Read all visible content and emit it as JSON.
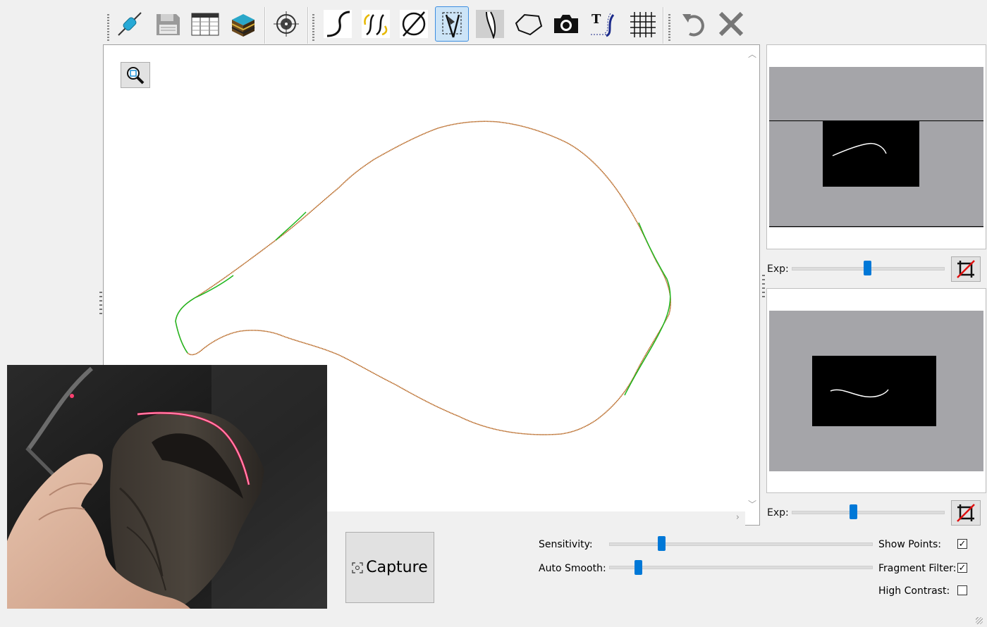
{
  "toolbar": {
    "buttons": [
      {
        "name": "connect-icon"
      },
      {
        "name": "save-icon"
      },
      {
        "name": "table-icon"
      },
      {
        "name": "layers-icon"
      },
      {
        "name": "target-icon"
      },
      {
        "name": "curve-icon"
      },
      {
        "name": "swap-curves-icon"
      },
      {
        "name": "diameter-icon"
      },
      {
        "name": "select-fragment-icon",
        "active": true
      },
      {
        "name": "profile-icon"
      },
      {
        "name": "polygon-icon"
      },
      {
        "name": "camera-icon"
      },
      {
        "name": "text-curve-icon"
      },
      {
        "name": "grid-icon"
      },
      {
        "name": "undo-icon"
      },
      {
        "name": "close-icon"
      }
    ]
  },
  "canvas": {
    "zoom_icon": "zoom-fit-icon",
    "curve_colors": {
      "main": "#b15a10",
      "highlight": "#1fb81f"
    }
  },
  "preview_top": {
    "exp_label": "Exp:",
    "exp_value": 0.5,
    "crop_icon": "crop-off-icon"
  },
  "preview_bottom": {
    "exp_label": "Exp:",
    "exp_value": 0.4,
    "crop_icon": "crop-off-icon"
  },
  "controls": {
    "capture_label": "Capture",
    "sensitivity_label": "Sensitivity:",
    "sensitivity_value": 0.19,
    "auto_smooth_label": "Auto Smooth:",
    "auto_smooth_value": 0.1,
    "show_points_label": "Show Points:",
    "show_points_checked": true,
    "fragment_filter_label": "Fragment Filter:",
    "fragment_filter_checked": true,
    "high_contrast_label": "High Contrast:",
    "high_contrast_checked": false
  },
  "colors": {
    "accent": "#0078d7",
    "active_button_bg": "#cce4f7",
    "laser": "#ff2a6a"
  }
}
